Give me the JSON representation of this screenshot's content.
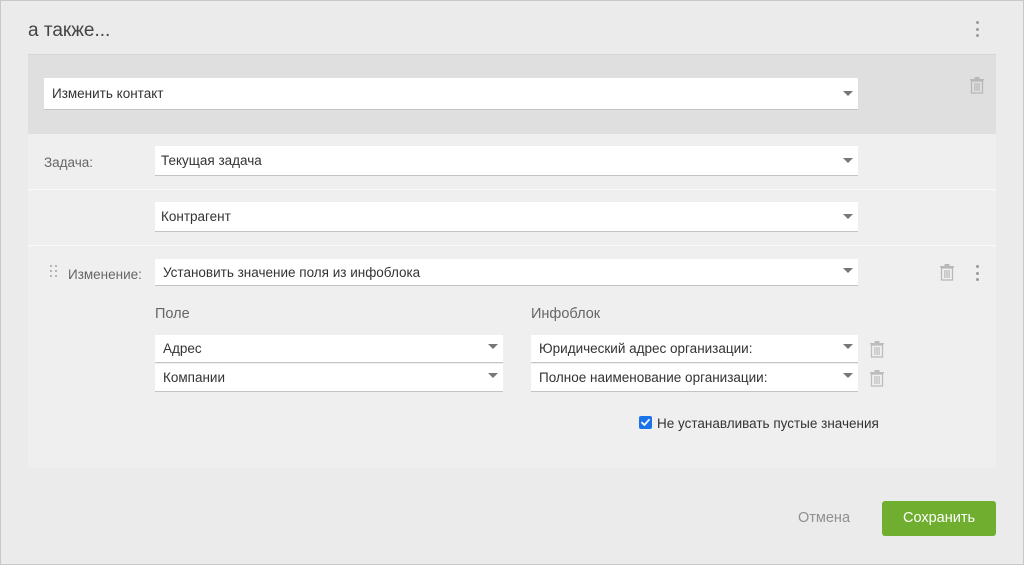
{
  "dialog": {
    "title": "а также..."
  },
  "action": {
    "select_value": "Изменить контакт"
  },
  "task": {
    "label": "Задача:",
    "select_value": "Текущая задача"
  },
  "entity": {
    "select_value": "Контрагент"
  },
  "change": {
    "label": "Изменение:",
    "select_value": "Установить значение поля из инфоблока",
    "field_column_header": "Поле",
    "infoblock_column_header": "Инфоблок",
    "rows": [
      {
        "field": "Адрес",
        "infoblock": "Юридический адрес организации:"
      },
      {
        "field": "Компании",
        "infoblock": "Полное наименование организации:"
      }
    ],
    "skip_empty": {
      "checked": true,
      "label": "Не устанавливать пустые значения"
    }
  },
  "footer": {
    "cancel_label": "Отмена",
    "save_label": "Сохранить"
  },
  "colors": {
    "save_button": "#6fae2e",
    "checkbox": "#1a73e8",
    "action_band": "#dfdfdf",
    "details_bg": "#efefef"
  },
  "icons": [
    "kebab-menu-icon",
    "trash-icon",
    "drag-handle-icon",
    "chevron-down-icon",
    "checkmark-icon"
  ]
}
